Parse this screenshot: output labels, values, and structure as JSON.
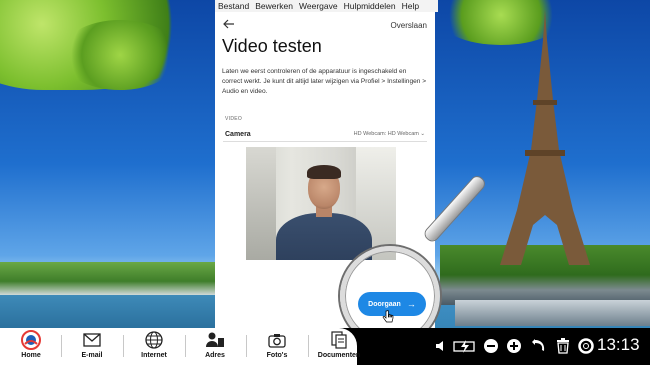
{
  "menubar": {
    "items": [
      "Bestand",
      "Bewerken",
      "Weergave",
      "Hulpmiddelen",
      "Help"
    ]
  },
  "app": {
    "back_icon": "arrow-left-icon",
    "skip_label": "Overslaan",
    "title": "Video testen",
    "description": "Laten we eerst controleren of de apparatuur is ingeschakeld en correct werkt. Je kunt dit altijd later wijzigen via Profiel > Instellingen > Audio en video.",
    "section_label": "VIDEO",
    "camera_label": "Camera",
    "camera_value": "HD Webcam: HD Webcam ⌄",
    "continue_label": "Doorgaan",
    "continue_icon": "arrow-right-icon",
    "accent_color": "#1e88e5"
  },
  "taskbar": {
    "items": [
      {
        "label": "Home",
        "icon": "home-logo-icon"
      },
      {
        "label": "E-mail",
        "icon": "envelope-icon"
      },
      {
        "label": "Internet",
        "icon": "globe-icon"
      },
      {
        "label": "Adres",
        "icon": "contacts-icon"
      },
      {
        "label": "Foto's",
        "icon": "camera-icon"
      },
      {
        "label": "Documenten",
        "icon": "documents-icon"
      }
    ],
    "tray_icons": [
      "volume-icon",
      "power-icon",
      "zoom-out-icon",
      "zoom-in-icon",
      "back-icon",
      "trash-icon",
      "help-icon"
    ],
    "clock": "13:13"
  }
}
